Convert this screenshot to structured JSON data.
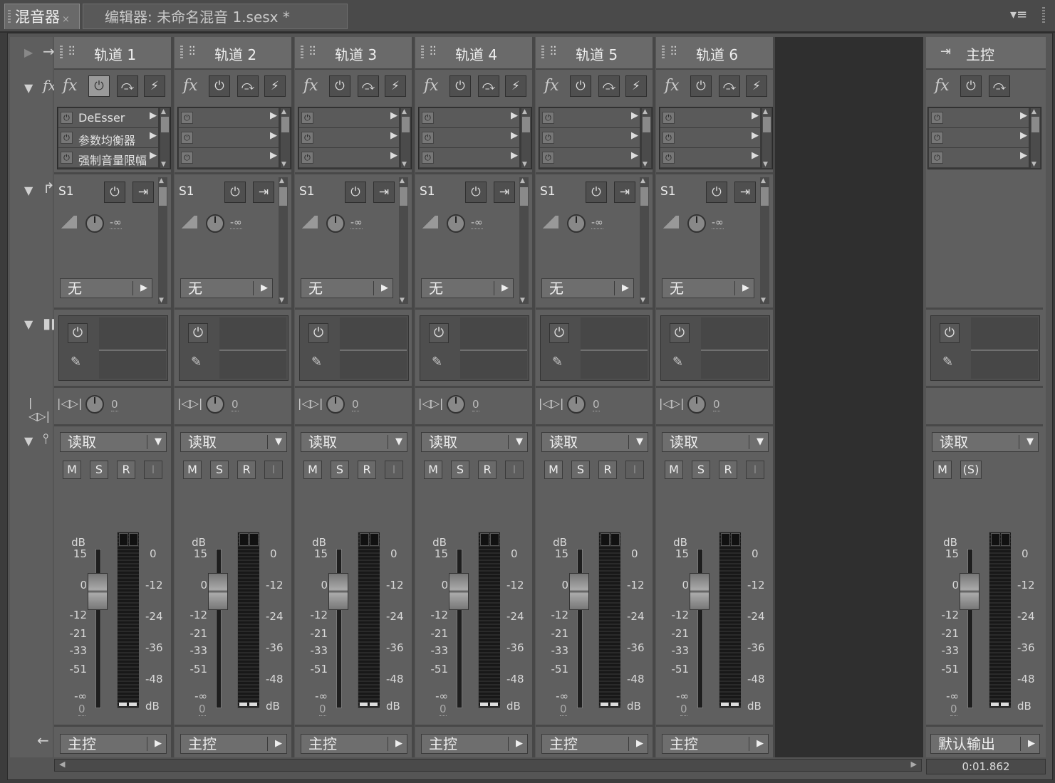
{
  "tabs": [
    {
      "label": "混音器",
      "close": "×"
    },
    {
      "label": "编辑器: 未命名混音 1.sesx *"
    }
  ],
  "tab_menu_icon": "panel-menu-icon",
  "tracks": [
    {
      "name": "轨道 1",
      "effects": [
        "DeEsser",
        "参数均衡器",
        "强制音量限幅"
      ],
      "send_name": "S1",
      "send_level": "-∞",
      "send_dest": "无",
      "pan": "0",
      "automation": "读取",
      "vol": "0",
      "output": "主控"
    },
    {
      "name": "轨道 2",
      "effects": [
        "",
        "",
        ""
      ],
      "send_name": "S1",
      "send_level": "-∞",
      "send_dest": "无",
      "pan": "0",
      "automation": "读取",
      "vol": "0",
      "output": "主控"
    },
    {
      "name": "轨道 3",
      "effects": [
        "",
        "",
        ""
      ],
      "send_name": "S1",
      "send_level": "-∞",
      "send_dest": "无",
      "pan": "0",
      "automation": "读取",
      "vol": "0",
      "output": "主控"
    },
    {
      "name": "轨道 4",
      "effects": [
        "",
        "",
        ""
      ],
      "send_name": "S1",
      "send_level": "-∞",
      "send_dest": "无",
      "pan": "0",
      "automation": "读取",
      "vol": "0",
      "output": "主控"
    },
    {
      "name": "轨道 5",
      "effects": [
        "",
        "",
        ""
      ],
      "send_name": "S1",
      "send_level": "-∞",
      "send_dest": "无",
      "pan": "0",
      "automation": "读取",
      "vol": "0",
      "output": "主控"
    },
    {
      "name": "轨道 6",
      "effects": [
        "",
        "",
        ""
      ],
      "send_name": "S1",
      "send_level": "-∞",
      "send_dest": "无",
      "pan": "0",
      "automation": "读取",
      "vol": "0",
      "output": "主控"
    }
  ],
  "master": {
    "name": "主控",
    "automation": "读取",
    "vol": "0",
    "output": "默认输出"
  },
  "buttons": {
    "mute": "M",
    "solo": "S",
    "rec": "R",
    "input": "I",
    "master_solo": "(S)",
    "fx": "fx"
  },
  "fader_scale": [
    "dB",
    "15",
    "0",
    "-12",
    "-21",
    "-33",
    "-51",
    "-∞"
  ],
  "meter_scale": [
    "0",
    "-12",
    "-24",
    "-36",
    "-48",
    "dB"
  ],
  "time_display": "0:01.862",
  "colors": {
    "panel": "#5f5f5f",
    "header": "#6a6a6a",
    "background": "#2f2f2f"
  }
}
